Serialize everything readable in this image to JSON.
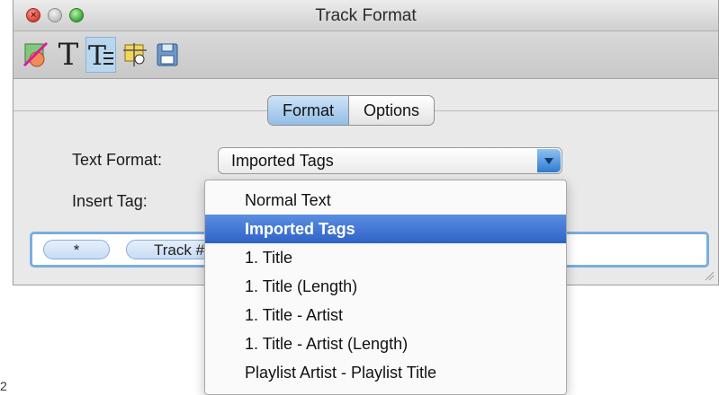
{
  "window": {
    "title": "Track Format"
  },
  "toolbar": {
    "items": [
      {
        "name": "color-swatch-icon",
        "selected": false
      },
      {
        "name": "text-icon",
        "glyph": "T",
        "selected": false
      },
      {
        "name": "text-format-icon",
        "glyph": "T",
        "selected": true
      },
      {
        "name": "image-position-icon",
        "selected": false
      },
      {
        "name": "save-icon",
        "selected": false
      }
    ]
  },
  "tabs": {
    "format_label": "Format",
    "options_label": "Options",
    "selected": "Format"
  },
  "form": {
    "text_format_label": "Text Format:",
    "text_format_value": "Imported Tags",
    "insert_tag_label": "Insert Tag:"
  },
  "token_field": {
    "tokens": [
      "*",
      "Track #"
    ]
  },
  "dropdown": {
    "items": [
      "Normal Text",
      "Imported Tags",
      "1. Title",
      "1. Title (Length)",
      "1. Title - Artist",
      "1. Title - Artist (Length)",
      "Playlist Artist - Playlist Title"
    ],
    "highlighted_index": 1
  },
  "stray_text": "2",
  "colors": {
    "selection_blue": "#2f62c7",
    "focus_ring": "#7aaede"
  }
}
